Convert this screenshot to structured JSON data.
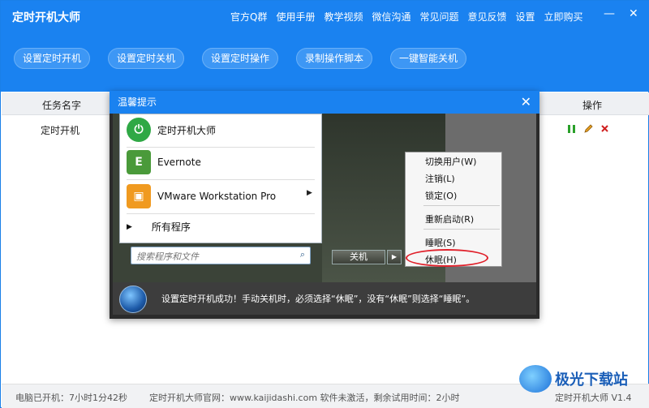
{
  "app": {
    "title": "定时开机大师",
    "nav": [
      "官方Q群",
      "使用手册",
      "教学视频",
      "微信沟通",
      "常见问题",
      "意见反馈",
      "设置",
      "立即购买"
    ],
    "minimize": "—",
    "close": "✕"
  },
  "toolbar": {
    "buttons": [
      "设置定时开机",
      "设置定时关机",
      "设置定时操作",
      "录制操作脚本",
      "一键智能关机"
    ]
  },
  "table": {
    "headers": {
      "task_name": "任务名字",
      "operation": "操作"
    },
    "rows": [
      {
        "name": "定时开机"
      }
    ],
    "op_icons": [
      "pause-icon",
      "edit-icon",
      "delete-icon"
    ]
  },
  "status": {
    "uptime": "电脑已开机：7小时1分42秒",
    "site": "定时开机大师官网：www.kaijidashi.com 软件未激活，剩余试用时间：2小时",
    "version": "定时开机大师 V1.4"
  },
  "dialog": {
    "title": "温馨提示",
    "close": "✕",
    "start_menu": {
      "items": [
        "定时开机大师",
        "Evernote",
        "VMware Workstation Pro"
      ],
      "all_programs": "所有程序",
      "search_placeholder": "搜索程序和文件",
      "shutdown": "关机"
    },
    "context_menu": [
      "切换用户(W)",
      "注销(L)",
      "锁定(O)",
      "重新启动(R)",
      "睡眠(S)",
      "休眠(H)"
    ],
    "message": "设置定时开机成功！手动关机时，必须选择“休眠”，没有“休眠”则选择“睡眠”。"
  },
  "watermark": "极光下载站",
  "colors": {
    "primary": "#1a82f0",
    "highlight_ring": "#e0202a"
  }
}
